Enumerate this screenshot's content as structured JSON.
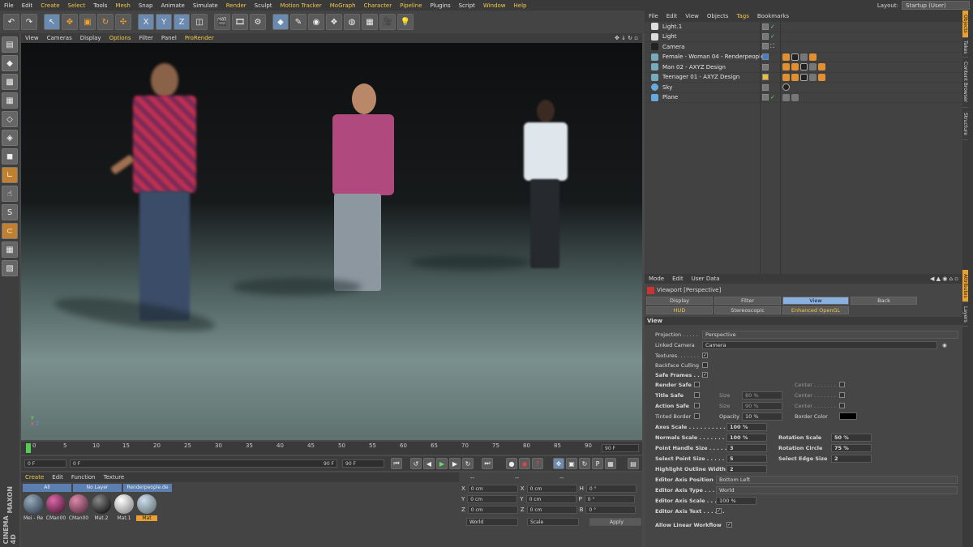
{
  "menubar": {
    "items": [
      "File",
      "Edit",
      "Create",
      "Select",
      "Tools",
      "Mesh",
      "Snap",
      "Animate",
      "Simulate",
      "Render",
      "Sculpt",
      "Motion Tracker",
      "MoGraph",
      "Character",
      "Pipeline",
      "Plugins",
      "Script",
      "Window",
      "Help"
    ],
    "layout_label": "Layout:",
    "layout_value": "Startup (User)"
  },
  "viewport": {
    "menu": [
      "View",
      "Cameras",
      "Display",
      "Options",
      "Filter",
      "Panel",
      "ProRender"
    ],
    "axes": {
      "y": "Y",
      "x": "X",
      "z": "Z"
    }
  },
  "timeline": {
    "ticks": [
      "0",
      "5",
      "10",
      "15",
      "20",
      "25",
      "30",
      "35",
      "40",
      "45",
      "50",
      "55",
      "60",
      "65",
      "70",
      "75",
      "80",
      "85",
      "90"
    ],
    "frame_end": "90 F",
    "start": "0 F",
    "slider_start": "0 F",
    "slider_end": "90 F",
    "end": "90 F"
  },
  "materials": {
    "menu": [
      "Create",
      "Edit",
      "Function",
      "Texture"
    ],
    "filters": [
      "All",
      "No Layer",
      "Renderpeople.de"
    ],
    "items": [
      "Mei - Re",
      "CMan00",
      "CMan00",
      "Mat.2",
      "Mat.1",
      "Mat"
    ]
  },
  "coords": {
    "head": [
      "--",
      "--",
      "--"
    ],
    "rows": [
      {
        "a": "X",
        "v1": "0 cm",
        "b": "X",
        "v2": "0 cm",
        "c": "H",
        "v3": "0 °"
      },
      {
        "a": "Y",
        "v1": "0 cm",
        "b": "Y",
        "v2": "0 cm",
        "c": "P",
        "v3": "0 °"
      },
      {
        "a": "Z",
        "v1": "0 cm",
        "b": "Z",
        "v2": "0 cm",
        "c": "B",
        "v3": "0 °"
      }
    ],
    "world": "World",
    "scale": "Scale",
    "apply": "Apply"
  },
  "objects": {
    "menu": [
      "File",
      "Edit",
      "View",
      "Objects",
      "Tags",
      "Bookmarks"
    ],
    "rows": [
      "Light.1",
      "Light",
      "Camera",
      "Female - Woman 04 - Renderpeople",
      "Man 02 - AXYZ Design",
      "Teenager 01 - AXYZ Design",
      "Sky",
      "Plane"
    ]
  },
  "attributes": {
    "menu": [
      "Mode",
      "Edit",
      "User Data"
    ],
    "title": "Viewport [Perspective]",
    "tabs": [
      "Display",
      "Filter",
      "View",
      "Back",
      "HUD",
      "Stereoscopic",
      "Enhanced OpenGL"
    ],
    "section": "View",
    "projection_label": "Projection . . . . .",
    "projection": "Perspective",
    "linked_camera_label": "Linked Camera",
    "linked_camera": "Camera",
    "textures": "Textures. . . . . . .",
    "backface": "Backface Culling",
    "safe_frames": "Safe Frames . . .",
    "render_safe": "Render Safe",
    "title_safe": "Title Safe",
    "action_safe": "Action Safe",
    "tinted_border": "Tinted Border",
    "size_label": "Size",
    "size_val": "80 %",
    "size_val2": "90 %",
    "opacity_label": "Opacity",
    "opacity": "10 %",
    "center_label": "Center . . . . . . .",
    "border_color": "Border Color",
    "axes_scale_label": "Axes Scale . . . . . . . . . . . . .",
    "axes_scale": "100 %",
    "normals_scale_label": "Normals Scale . . . . . . . . . .",
    "normals_scale": "100 %",
    "point_handle_label": "Point Handle Size . . . . . . .",
    "point_handle": "3",
    "select_point_label": "Select Point Size . . . . . . .",
    "select_point": "5",
    "highlight_label": "Highlight Outline Width",
    "highlight": "2",
    "rotation_scale_label": "Rotation Scale",
    "rotation_scale": "50 %",
    "rotation_circle_label": "Rotation Circle",
    "rotation_circle": "75 %",
    "select_edge_label": "Select Edge Size",
    "select_edge": "2",
    "axis_position_label": "Editor Axis Position",
    "axis_position": "Bottom Left",
    "axis_type_label": "Editor Axis Type . . .",
    "axis_type": "World",
    "axis_scale_label": "Editor Axis Scale . . .",
    "axis_scale": "100 %",
    "axis_text_label": "Editor Axis Text . . . . . .",
    "linear_label": "Allow Linear Workflow"
  },
  "side_tabs": [
    "Objects",
    "Takes",
    "Content Browser",
    "Structure",
    "Attributes",
    "Layers"
  ],
  "brand": {
    "maxon": "MAXON",
    "product": "CINEMA 4D"
  }
}
